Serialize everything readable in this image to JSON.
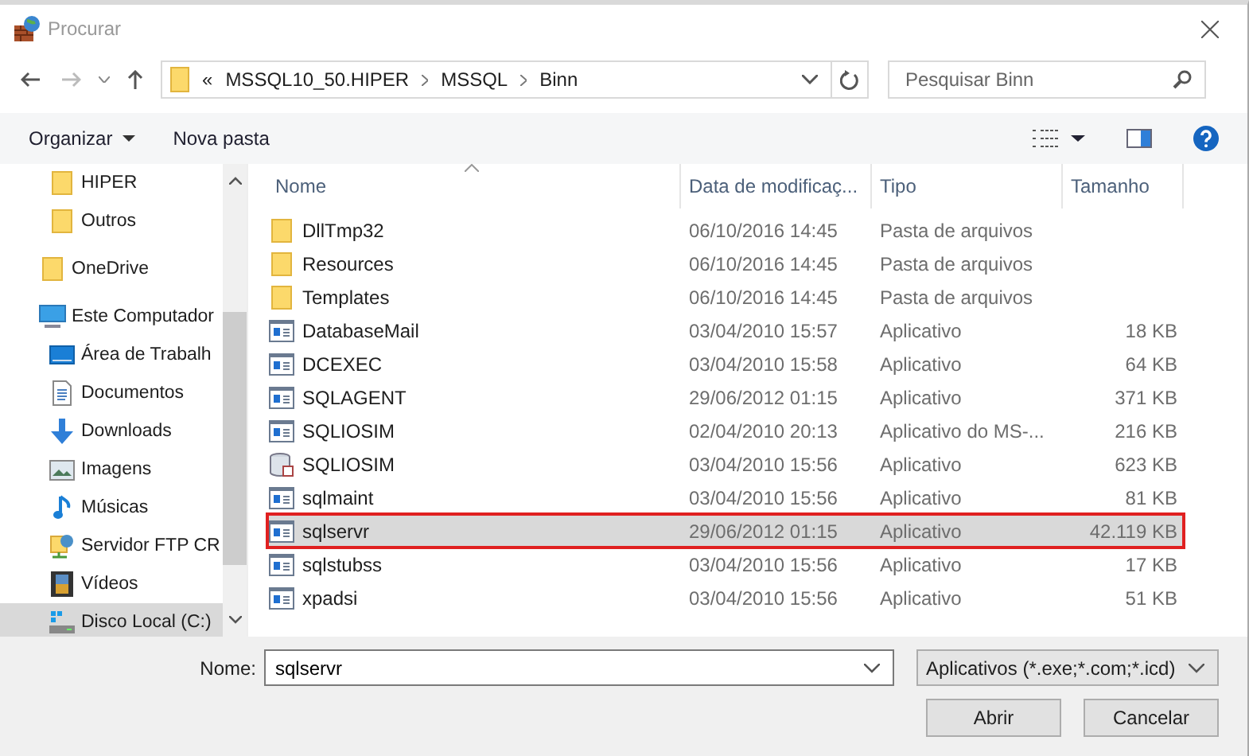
{
  "window": {
    "title": "Procurar"
  },
  "address": {
    "overflow": "«",
    "crumbs": [
      "MSSQL10_50.HIPER",
      "MSSQL",
      "Binn"
    ]
  },
  "search": {
    "placeholder": "Pesquisar Binn"
  },
  "toolbar": {
    "organize": "Organizar",
    "new_folder": "Nova pasta"
  },
  "sidebar": {
    "nested_items": [
      {
        "label": "HIPER",
        "kind": "folder",
        "selected": false
      },
      {
        "label": "Outros",
        "kind": "folder",
        "selected": false
      }
    ],
    "items": [
      {
        "label": "OneDrive",
        "kind": "folder",
        "selected": false
      },
      {
        "label": "Este Computador",
        "kind": "computer",
        "selected": false,
        "children": [
          {
            "label": "Área de Trabalh",
            "kind": "desktop",
            "selected": false
          },
          {
            "label": "Documentos",
            "kind": "documents",
            "selected": false
          },
          {
            "label": "Downloads",
            "kind": "download",
            "selected": false
          },
          {
            "label": "Imagens",
            "kind": "images",
            "selected": false
          },
          {
            "label": "Músicas",
            "kind": "music",
            "selected": false
          },
          {
            "label": "Servidor FTP CR",
            "kind": "ftp",
            "selected": false
          },
          {
            "label": "Vídeos",
            "kind": "video",
            "selected": false
          },
          {
            "label": "Disco Local (C:)",
            "kind": "drive",
            "selected": true
          }
        ]
      }
    ]
  },
  "table": {
    "columns": [
      "Nome",
      "Data de modificaç...",
      "Tipo",
      "Tamanho"
    ],
    "rows": [
      {
        "kind": "folder",
        "name": "DllTmp32",
        "date": "06/10/2016 14:45",
        "type": "Pasta de arquivos",
        "size": "",
        "selected": false,
        "outlined": false
      },
      {
        "kind": "folder",
        "name": "Resources",
        "date": "06/10/2016 14:45",
        "type": "Pasta de arquivos",
        "size": "",
        "selected": false,
        "outlined": false
      },
      {
        "kind": "folder",
        "name": "Templates",
        "date": "06/10/2016 14:45",
        "type": "Pasta de arquivos",
        "size": "",
        "selected": false,
        "outlined": false
      },
      {
        "kind": "app",
        "name": "DatabaseMail",
        "date": "03/04/2010 15:57",
        "type": "Aplicativo",
        "size": "18 KB",
        "selected": false,
        "outlined": false
      },
      {
        "kind": "app",
        "name": "DCEXEC",
        "date": "03/04/2010 15:58",
        "type": "Aplicativo",
        "size": "64 KB",
        "selected": false,
        "outlined": false
      },
      {
        "kind": "app",
        "name": "SQLAGENT",
        "date": "29/06/2012 01:15",
        "type": "Aplicativo",
        "size": "371 KB",
        "selected": false,
        "outlined": false
      },
      {
        "kind": "app",
        "name": "SQLIOSIM",
        "date": "02/04/2010 20:13",
        "type": "Aplicativo do MS-...",
        "size": "216 KB",
        "selected": false,
        "outlined": false
      },
      {
        "kind": "database",
        "name": "SQLIOSIM",
        "date": "03/04/2010 15:56",
        "type": "Aplicativo",
        "size": "623 KB",
        "selected": false,
        "outlined": false
      },
      {
        "kind": "app",
        "name": "sqlmaint",
        "date": "03/04/2010 15:56",
        "type": "Aplicativo",
        "size": "81 KB",
        "selected": false,
        "outlined": false
      },
      {
        "kind": "app",
        "name": "sqlservr",
        "date": "29/06/2012 01:15",
        "type": "Aplicativo",
        "size": "42.119 KB",
        "selected": true,
        "outlined": true
      },
      {
        "kind": "app",
        "name": "sqlstubss",
        "date": "03/04/2010 15:56",
        "type": "Aplicativo",
        "size": "17 KB",
        "selected": false,
        "outlined": false
      },
      {
        "kind": "app",
        "name": "xpadsi",
        "date": "03/04/2010 15:56",
        "type": "Aplicativo",
        "size": "51 KB",
        "selected": false,
        "outlined": false
      }
    ]
  },
  "footer": {
    "name_label": "Nome:",
    "name_value": "sqlservr",
    "filter": "Aplicativos (*.exe;*.com;*.icd)",
    "buttons": [
      "Abrir",
      "Cancelar"
    ]
  }
}
